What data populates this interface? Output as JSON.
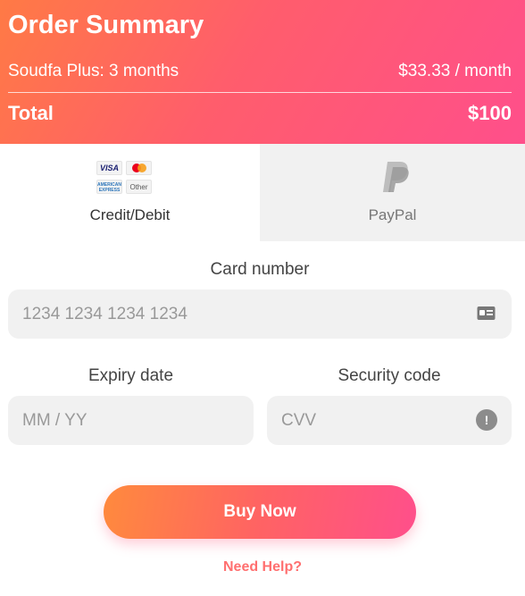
{
  "summary": {
    "title": "Order Summary",
    "plan_name": "Soudfa Plus: 3 months",
    "plan_price": "$33.33 / month",
    "total_label": "Total",
    "total_value": "$100"
  },
  "tabs": {
    "card_label": "Credit/Debit",
    "paypal_label": "PayPal",
    "card_logos": {
      "visa": "VISA",
      "amex": "AMERICAN EXPRESS",
      "other": "Other"
    }
  },
  "form": {
    "card_number_label": "Card number",
    "card_number_placeholder": "1234 1234 1234 1234",
    "expiry_label": "Expiry date",
    "expiry_placeholder": "MM / YY",
    "security_label": "Security code",
    "cvv_placeholder": "CVV"
  },
  "actions": {
    "buy_label": "Buy Now",
    "help_label": "Need Help?"
  },
  "colors": {
    "gradient_start": "#ff7a45",
    "gradient_end": "#ff4f8b",
    "help_link": "#ff6f6f",
    "field_background": "#f1f1f1"
  },
  "icons": {
    "card_field": "id-card-icon",
    "cvv_field": "info-icon",
    "paypal": "paypal-icon"
  }
}
